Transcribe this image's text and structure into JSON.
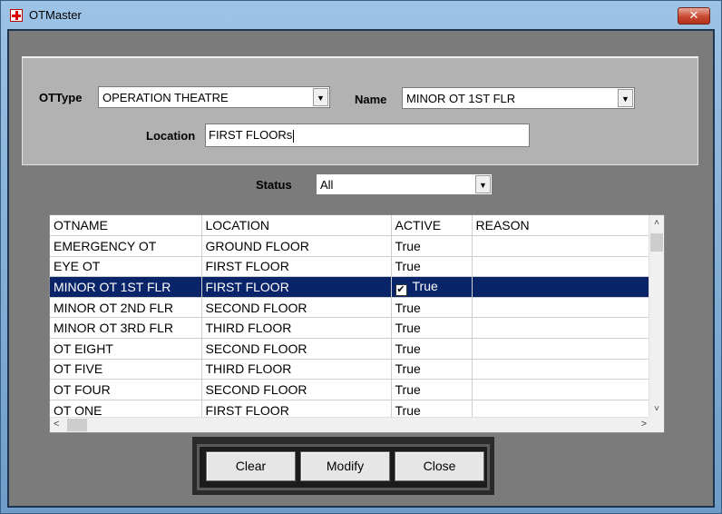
{
  "window": {
    "title": "OTMaster",
    "close_glyph": "✕",
    "app_icon": "red-cross-icon"
  },
  "filters": {
    "ottype_label": "OTType",
    "ottype_value": "OPERATION THEATRE",
    "name_label": "Name",
    "name_value": "MINOR OT 1ST FLR",
    "location_label": "Location",
    "location_value": "FIRST FLOORs",
    "status_label": "Status",
    "status_value": "All",
    "dropdown_glyph": "▼"
  },
  "grid": {
    "columns": [
      "OTNAME",
      "LOCATION",
      "ACTIVE",
      "REASON"
    ],
    "rows": [
      {
        "otname": "EMERGENCY OT",
        "location": "GROUND FLOOR",
        "active": "True",
        "reason": ""
      },
      {
        "otname": "EYE OT",
        "location": "FIRST FLOOR",
        "active": "True",
        "reason": ""
      },
      {
        "otname": "MINOR OT 1ST FLR",
        "location": "FIRST FLOOR",
        "active": "True",
        "reason": "",
        "selected": true,
        "checked": true
      },
      {
        "otname": "MINOR OT 2ND FLR",
        "location": "SECOND FLOOR",
        "active": "True",
        "reason": ""
      },
      {
        "otname": "MINOR OT 3RD FLR",
        "location": "THIRD FLOOR",
        "active": "True",
        "reason": ""
      },
      {
        "otname": "OT EIGHT",
        "location": "SECOND FLOOR",
        "active": "True",
        "reason": ""
      },
      {
        "otname": "OT FIVE",
        "location": "THIRD FLOOR",
        "active": "True",
        "reason": ""
      },
      {
        "otname": "OT FOUR",
        "location": "SECOND FLOOR",
        "active": "True",
        "reason": ""
      },
      {
        "otname": "OT ONE",
        "location": "FIRST FLOOR",
        "active": "True",
        "reason": ""
      }
    ],
    "scroll_up": "˄",
    "scroll_down": "˅",
    "scroll_left": "<",
    "scroll_right": ">"
  },
  "buttons": {
    "clear": "Clear",
    "modify": "Modify",
    "close": "Close"
  },
  "colors": {
    "selection": "#0a246a",
    "client_bg": "#7b7b7b",
    "panel_bg": "#b2b2b2"
  }
}
